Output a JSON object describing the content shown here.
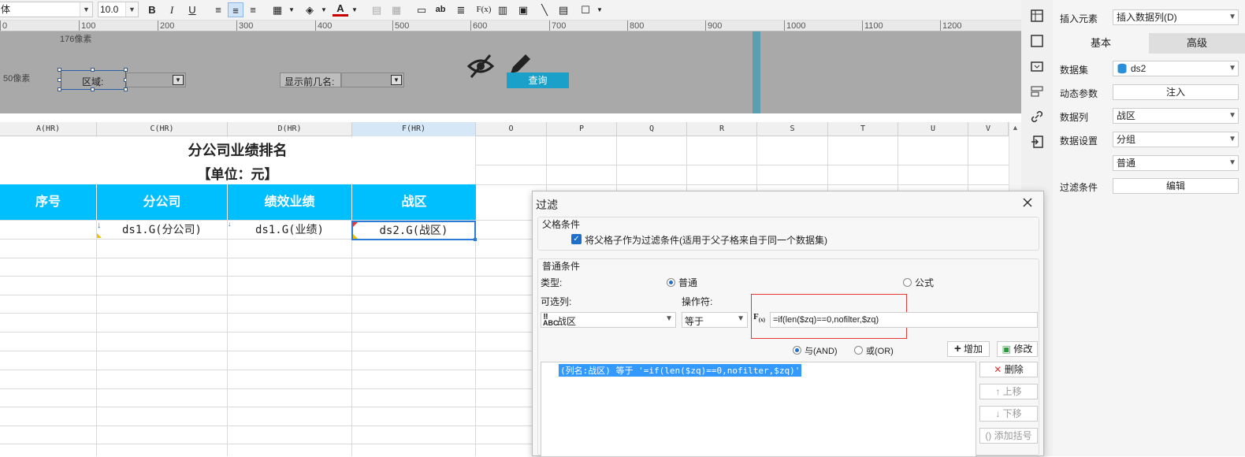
{
  "toolbar": {
    "font_name": "体",
    "font_size": "10.0",
    "bold": "B",
    "italic": "I",
    "underline": "U",
    "font_color_glyph": "A",
    "text_tool": "ab",
    "formula_tool": "F(x)",
    "accent_color": "#cfe4f8"
  },
  "ruler": {
    "ticks": [
      "0",
      "100",
      "200",
      "300",
      "400",
      "500",
      "600",
      "700",
      "800",
      "900",
      "1000",
      "1100",
      "1200"
    ]
  },
  "param_panel": {
    "width_label": "176像素",
    "height_label": "50像素",
    "region_label": "区域:",
    "topn_label": "显示前几名:",
    "query_button": "查询",
    "query_color": "#1ba1c9",
    "bg_color": "#a9a9a9"
  },
  "columns": [
    "A(HR)",
    "C(HR)",
    "D(HR)",
    "F(HR)",
    "O",
    "P",
    "Q",
    "R",
    "S",
    "T",
    "U",
    "V"
  ],
  "report": {
    "title": "分公司业绩排名",
    "unit": "【单位：元】",
    "headers": [
      "序号",
      "分公司",
      "绩效业绩",
      "战区"
    ],
    "header_color": "#00bfff",
    "cells": [
      "ds1.G(分公司)",
      "ds1.G(业绩)",
      "ds2.G(战区)"
    ]
  },
  "right_panel": {
    "insert_label": "插入元素",
    "insert_value": "插入数据列(D)",
    "tab_basic": "基本",
    "tab_advanced": "高级",
    "dataset_label": "数据集",
    "dataset_value": "ds2",
    "dynamic_param_label": "动态参数",
    "dynamic_param_button": "注入",
    "column_label": "数据列",
    "column_value": "战区",
    "setting_label": "数据设置",
    "setting_value": "分组",
    "setting_value2": "普通",
    "filter_label": "过滤条件",
    "filter_button": "编辑"
  },
  "dialog": {
    "title": "过滤",
    "parent_group": "父格条件",
    "parent_checkbox": "将父格子作为过滤条件(适用于父子格来自于同一个数据集)",
    "normal_group": "普通条件",
    "type_label": "类型:",
    "type_normal": "普通",
    "type_formula": "公式",
    "column_label": "可选列:",
    "column_value": "战区",
    "operator_label": "操作符:",
    "operator_value": "等于",
    "formula_value": "=if(len($zq)==0,nofilter,$zq)",
    "and_label": "与(AND)",
    "or_label": "或(OR)",
    "add_button": "增加",
    "modify_button": "修改",
    "delete_button": "删除",
    "up_button": "上移",
    "down_button": "下移",
    "add_bracket_button": "添加括号",
    "condition_item": "(列名:战区) 等于 '=if(len($zq)==0,nofilter,$zq)'",
    "highlight_color": "#3399ff",
    "formula_box_border": "#e53935"
  }
}
